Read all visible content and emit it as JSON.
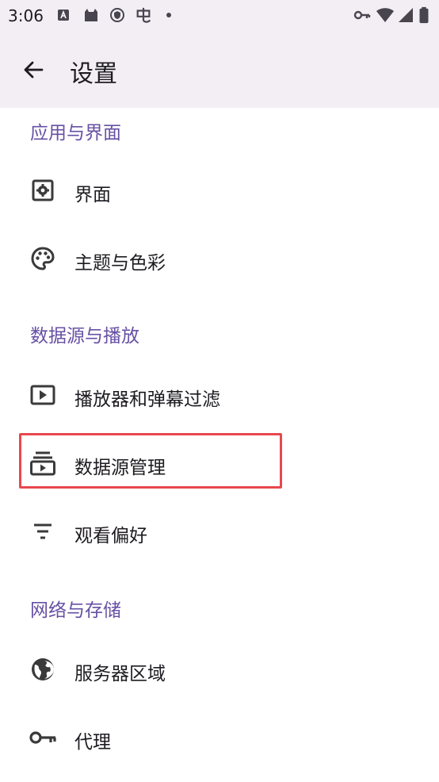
{
  "status_bar": {
    "time": "3:06"
  },
  "app_bar": {
    "title": "设置"
  },
  "sections": [
    {
      "header": "应用与界面",
      "items": [
        {
          "label": "界面",
          "icon": "settings-gear-icon"
        },
        {
          "label": "主题与色彩",
          "icon": "palette-icon"
        }
      ]
    },
    {
      "header": "数据源与播放",
      "items": [
        {
          "label": "播放器和弹幕过滤",
          "icon": "play-box-icon"
        },
        {
          "label": "数据源管理",
          "icon": "stacked-media-icon"
        },
        {
          "label": "观看偏好",
          "icon": "filter-lines-icon"
        }
      ]
    },
    {
      "header": "网络与存储",
      "items": [
        {
          "label": "服务器区域",
          "icon": "globe-icon"
        },
        {
          "label": "代理",
          "icon": "key-icon"
        }
      ]
    }
  ],
  "colors": {
    "accent": "#6750a4",
    "app_bar_bg": "#f3eef4",
    "highlight": "#e8484e"
  }
}
